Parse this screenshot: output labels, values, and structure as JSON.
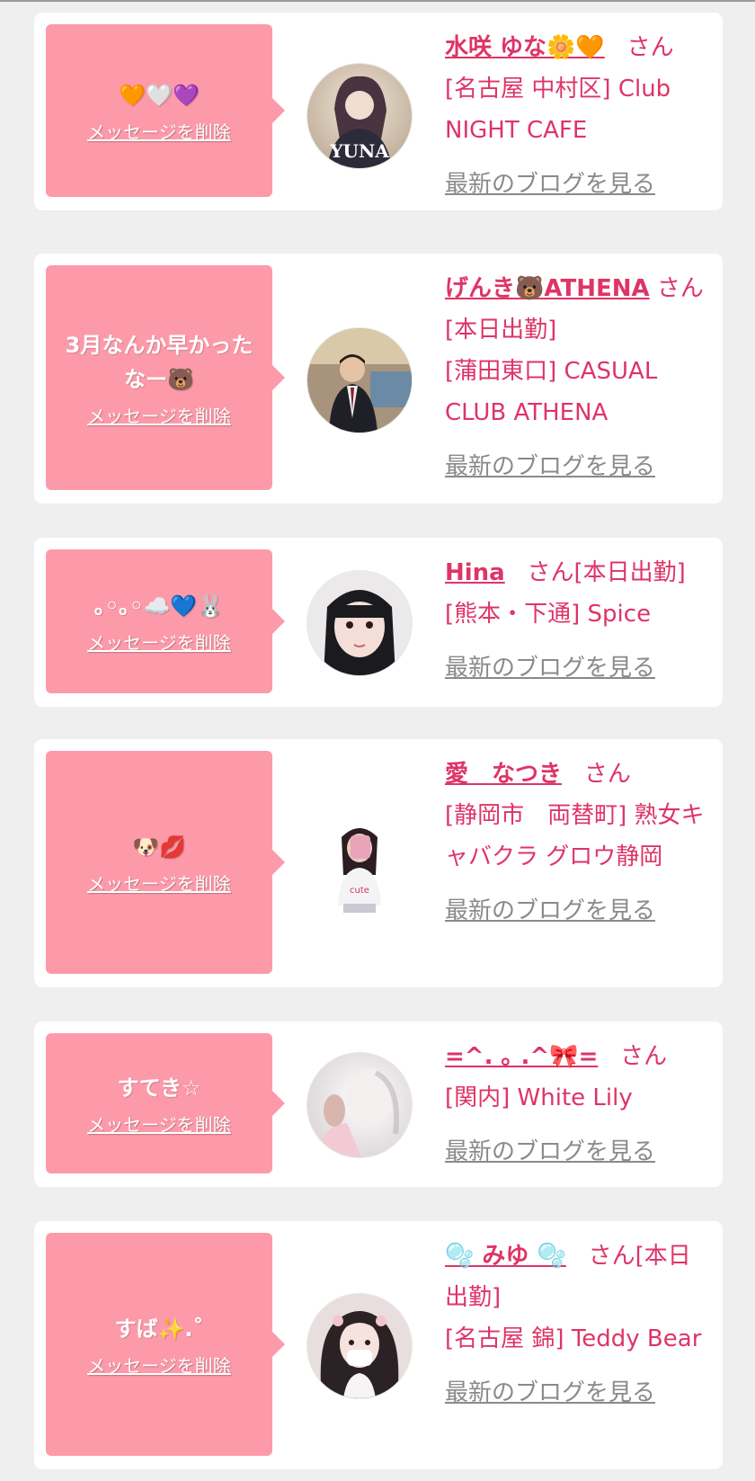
{
  "delete_label": "メッセージを削除",
  "blog_label": "最新のブログを見る",
  "colors": {
    "background": "#efefef",
    "card": "#ffffff",
    "bubble": "#fd9aa9",
    "accent": "#de3468",
    "link_gray": "#8a8a8a"
  },
  "cards": [
    {
      "message": "🧡🤍💜",
      "name": "水咲 ゆな🌼🧡",
      "suffix": "さん",
      "store": "[名古屋 中村区] Club NIGHT CAFE",
      "avatar_icon": "photo-yuna"
    },
    {
      "message": "3月なんか早かったなー🐻",
      "name": "げんき🐻ATHENA",
      "suffix": "さん[本日出勤]",
      "store": "[蒲田東口] CASUAL CLUB ATHENA",
      "avatar_icon": "photo-genki"
    },
    {
      "message": "｡◦｡◦☁️💙🐰",
      "name": "Hina",
      "suffix": "さん[本日出勤]",
      "store": "[熊本・下通] Spice",
      "avatar_icon": "photo-hina"
    },
    {
      "message": "🐶💋",
      "name": "愛　なつき",
      "suffix": "さん",
      "store": "[静岡市　両替町] 熟女キャバクラ グロウ静岡",
      "avatar_icon": "photo-natsuki"
    },
    {
      "message": "すてき☆",
      "name": "=^. ｡ .^🎀=",
      "suffix": "さん",
      "store": "[関内] White Lily",
      "avatar_icon": "photo-whitelily"
    },
    {
      "message": "すば✨.˚",
      "name": "🫧 みゆ 🫧",
      "suffix": "さん[本日出勤]",
      "store": "[名古屋 錦] Teddy Bear",
      "avatar_icon": "photo-miyu"
    }
  ]
}
